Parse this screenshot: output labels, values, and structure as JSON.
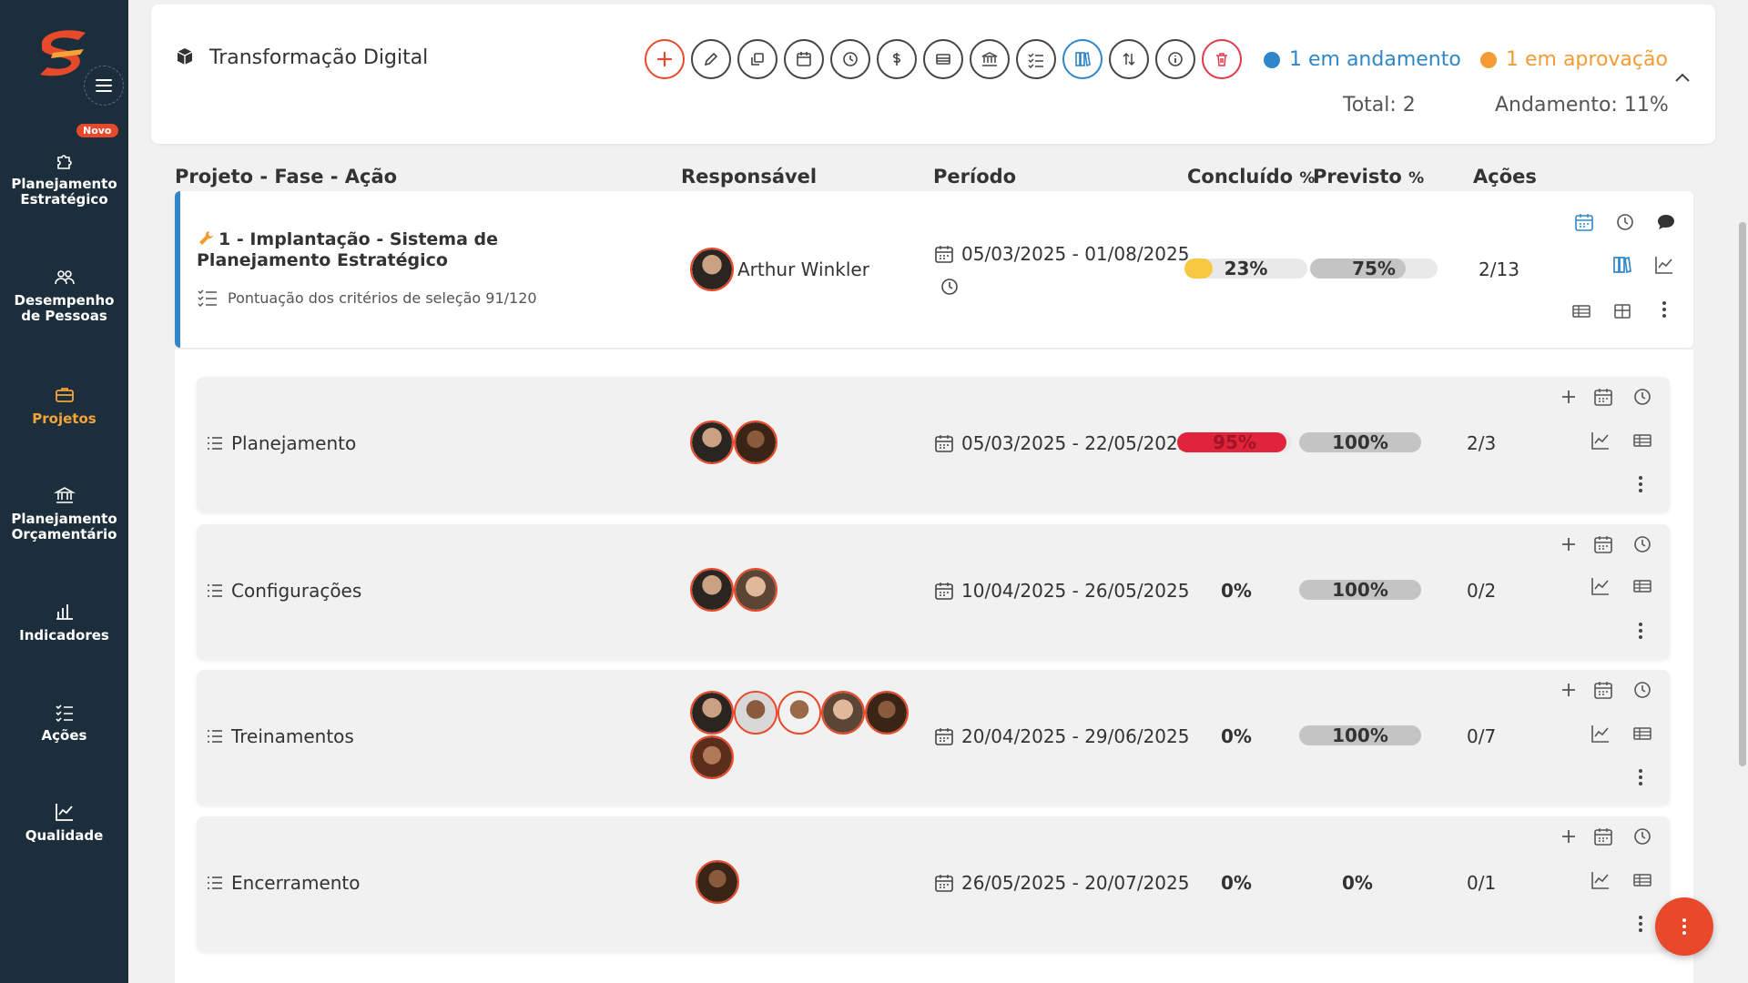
{
  "sidebar": {
    "badge": "Novo",
    "items": [
      {
        "label1": "Planejamento",
        "label2": "Estratégico"
      },
      {
        "label1": "Desempenho",
        "label2": "de Pessoas"
      },
      {
        "label1": "Projetos",
        "label2": ""
      },
      {
        "label1": "Planejamento",
        "label2": "Orçamentário"
      },
      {
        "label1": "Indicadores",
        "label2": ""
      },
      {
        "label1": "Ações",
        "label2": ""
      },
      {
        "label1": "Qualidade",
        "label2": ""
      }
    ]
  },
  "header": {
    "title": "Transformação Digital",
    "status_running": "1 em andamento",
    "status_approval": "1 em aprovação",
    "total": "Total: 2",
    "progress": "Andamento: 11%"
  },
  "columns": {
    "project": "Projeto - Fase - Ação",
    "responsible": "Responsável",
    "period": "Período",
    "done": "Concluído",
    "planned": "Previsto",
    "pct": "%",
    "actions": "Ações"
  },
  "project": {
    "name": "1 - Implantação - Sistema de Planejamento Estratégico",
    "criteria": "Pontuação dos critérios de seleção 91/120",
    "responsible": "Arthur Winkler",
    "period": "05/03/2025 - 01/08/2025",
    "done_label": "23%",
    "done_value": 0.23,
    "planned_label": "75%",
    "planned_value": 0.75,
    "actions": "2/13"
  },
  "phases": [
    {
      "name": "Planejamento",
      "period": "05/03/2025 - 22/05/2025",
      "done_label": "95%",
      "done_value": 0.95,
      "planned_label": "100%",
      "planned_value": 1.0,
      "actions": "2/3"
    },
    {
      "name": "Configurações",
      "period": "10/04/2025 - 26/05/2025",
      "done_label": "0%",
      "done_value": 0,
      "planned_label": "100%",
      "planned_value": 1.0,
      "actions": "0/2"
    },
    {
      "name": "Treinamentos",
      "period": "20/04/2025 - 29/06/2025",
      "done_label": "0%",
      "done_value": 0,
      "planned_label": "100%",
      "planned_value": 1.0,
      "actions": "0/7"
    },
    {
      "name": "Encerramento",
      "period": "26/05/2025 - 20/07/2025",
      "done_label": "0%",
      "done_value": 0,
      "planned_label": "0%",
      "planned_value": 0,
      "actions": "0/1"
    }
  ],
  "colors": {
    "accent": "#e8492a",
    "running": "#2f86c8",
    "approval": "#f39c33",
    "done_yellow": "#f7c842",
    "done_red": "#e0243b",
    "planned_gray": "#c4c4c4"
  }
}
